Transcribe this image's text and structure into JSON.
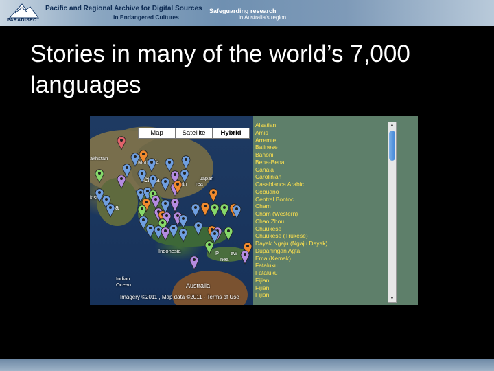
{
  "header": {
    "org_line1": "Pacific and Regional Archive for Digital Sources",
    "org_line2": "in Endangered Cultures",
    "logo_text": "PARADISEC",
    "tagline1": "Safeguarding research",
    "tagline2": "in Australia's region"
  },
  "slide": {
    "title": "Stories in many of the world’s 7,000 languages"
  },
  "map": {
    "types": [
      "Map",
      "Satellite",
      "Hybrid"
    ],
    "selected_type": "Hybrid",
    "labels": {
      "mongolia": "Mongolia",
      "china": "China",
      "japan": "Japan",
      "south": "South",
      "rea": "rea",
      "india": "dia",
      "khstan": "akhstan",
      "kista": "kista",
      "indonesia": "Indonesia",
      "png": "P",
      "ew": "ew",
      "nea": "nea",
      "indian_ocean1": "Indian",
      "indian_ocean2": "Ocean",
      "australia": "Australia"
    },
    "attribution": "Imagery ©2011 , Map data ©2011 - Terms of Use",
    "pin_colors": {
      "blue": "#6f9fe0",
      "purple": "#b48be0",
      "green": "#86d86a",
      "orange": "#f08a2e",
      "red": "#e0636a"
    }
  },
  "languages": [
    "Alsatian",
    "Amis",
    "Arremte",
    "Balinese",
    "Banoni",
    "Bena-Bena",
    "Canala",
    "Carolinian",
    "Casablanca Arabic",
    "Cebuano",
    "Central Bontoc",
    "Cham",
    "Cham (Western)",
    "Chao Zhou",
    "Chuukese",
    "Chuukese (Trukese)",
    "Dayak Ngaju (Ngaju Dayak)",
    "Dupaningan Agta",
    "Ema (Kemak)",
    "Fataluku",
    "Fataluku",
    "Fijian",
    "Fijian",
    "Fijian"
  ]
}
